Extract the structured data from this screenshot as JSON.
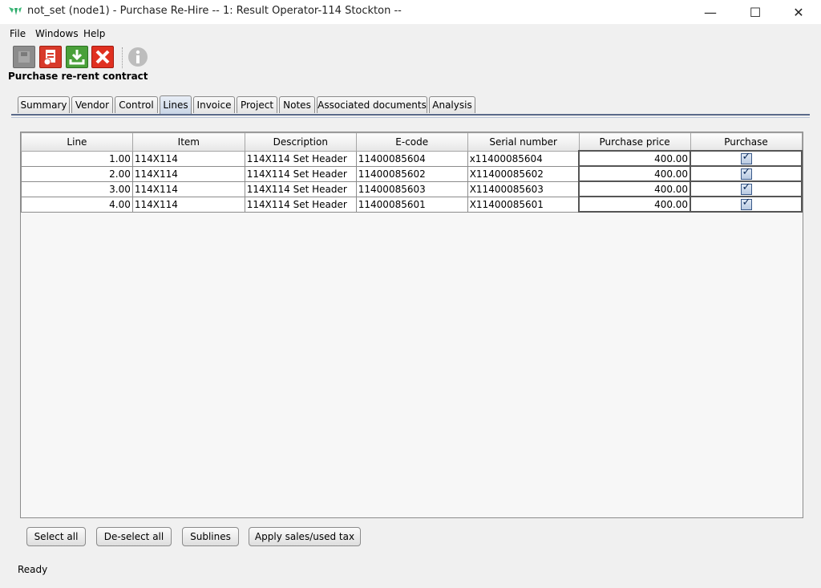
{
  "window": {
    "title": "not_set (node1) - Purchase Re-Hire -- 1: Result Operator-114 Stockton --",
    "minimize": "—",
    "maximize": "☐",
    "close": "✕"
  },
  "menu": [
    "File",
    "Windows",
    "Help"
  ],
  "toolbar": {
    "icons": [
      "save-icon",
      "delete-document-icon",
      "download-icon",
      "cancel-icon",
      "info-icon"
    ]
  },
  "page_title": "Purchase re-rent contract",
  "tabs": [
    "Summary",
    "Vendor",
    "Control",
    "Lines",
    "Invoice",
    "Project",
    "Notes",
    "Associated documents",
    "Analysis"
  ],
  "active_tab": "Lines",
  "table": {
    "columns": [
      "Line",
      "Item",
      "Description",
      "E-code",
      "Serial number",
      "Purchase price",
      "Purchase"
    ],
    "rows": [
      {
        "line": "1.00",
        "item": "114X114",
        "description": "114X114  Set Header",
        "ecode": "11400085604",
        "serial": "x11400085604",
        "price": "400.00",
        "purchase": "✓"
      },
      {
        "line": "2.00",
        "item": "114X114",
        "description": "114X114  Set Header",
        "ecode": "11400085602",
        "serial": "X11400085602",
        "price": "400.00",
        "purchase": "✓"
      },
      {
        "line": "3.00",
        "item": "114X114",
        "description": "114X114  Set Header",
        "ecode": "11400085603",
        "serial": "X11400085603",
        "price": "400.00",
        "purchase": "✓"
      },
      {
        "line": "4.00",
        "item": "114X114",
        "description": "114X114  Set Header",
        "ecode": "11400085601",
        "serial": "X11400085601",
        "price": "400.00",
        "purchase": "✓"
      }
    ]
  },
  "buttons": {
    "select_all": "Select all",
    "deselect_all": "De-select all",
    "sublines": "Sublines",
    "apply_tax": "Apply sales/used tax"
  },
  "status": "Ready",
  "colors": {
    "accent": "#5a6a8a",
    "save": "#888888",
    "delete": "#d83a2a",
    "download": "#4aa03a",
    "cancel": "#e03020",
    "info": "#bdbdbd"
  }
}
